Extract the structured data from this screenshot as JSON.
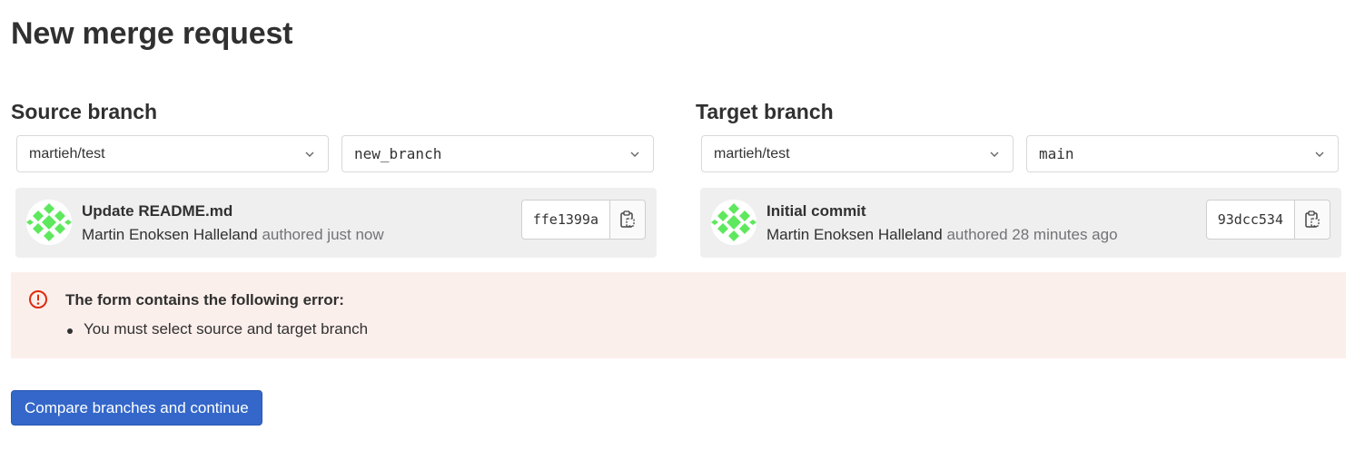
{
  "page": {
    "title": "New merge request"
  },
  "source": {
    "heading": "Source branch",
    "project": "martieh/test",
    "branch": "new_branch",
    "commit": {
      "title": "Update README.md",
      "author": "Martin Enoksen Halleland",
      "authored": "authored just now",
      "sha": "ffe1399a"
    }
  },
  "target": {
    "heading": "Target branch",
    "project": "martieh/test",
    "branch": "main",
    "commit": {
      "title": "Initial commit",
      "author": "Martin Enoksen Halleland",
      "authored": "authored 28 minutes ago",
      "sha": "93dcc534"
    }
  },
  "alert": {
    "title": "The form contains the following error:",
    "errors": [
      "You must select source and target branch"
    ],
    "icon": "error-icon",
    "color": "#dd2b0e"
  },
  "actions": {
    "submit_label": "Compare branches and continue"
  },
  "colors": {
    "primary": "#3467c9",
    "alert_bg": "#fbefec",
    "avatar": "#5ee85e"
  },
  "icons": {
    "dropdown": "chevron-down-icon",
    "copy": "clipboard-icon"
  }
}
